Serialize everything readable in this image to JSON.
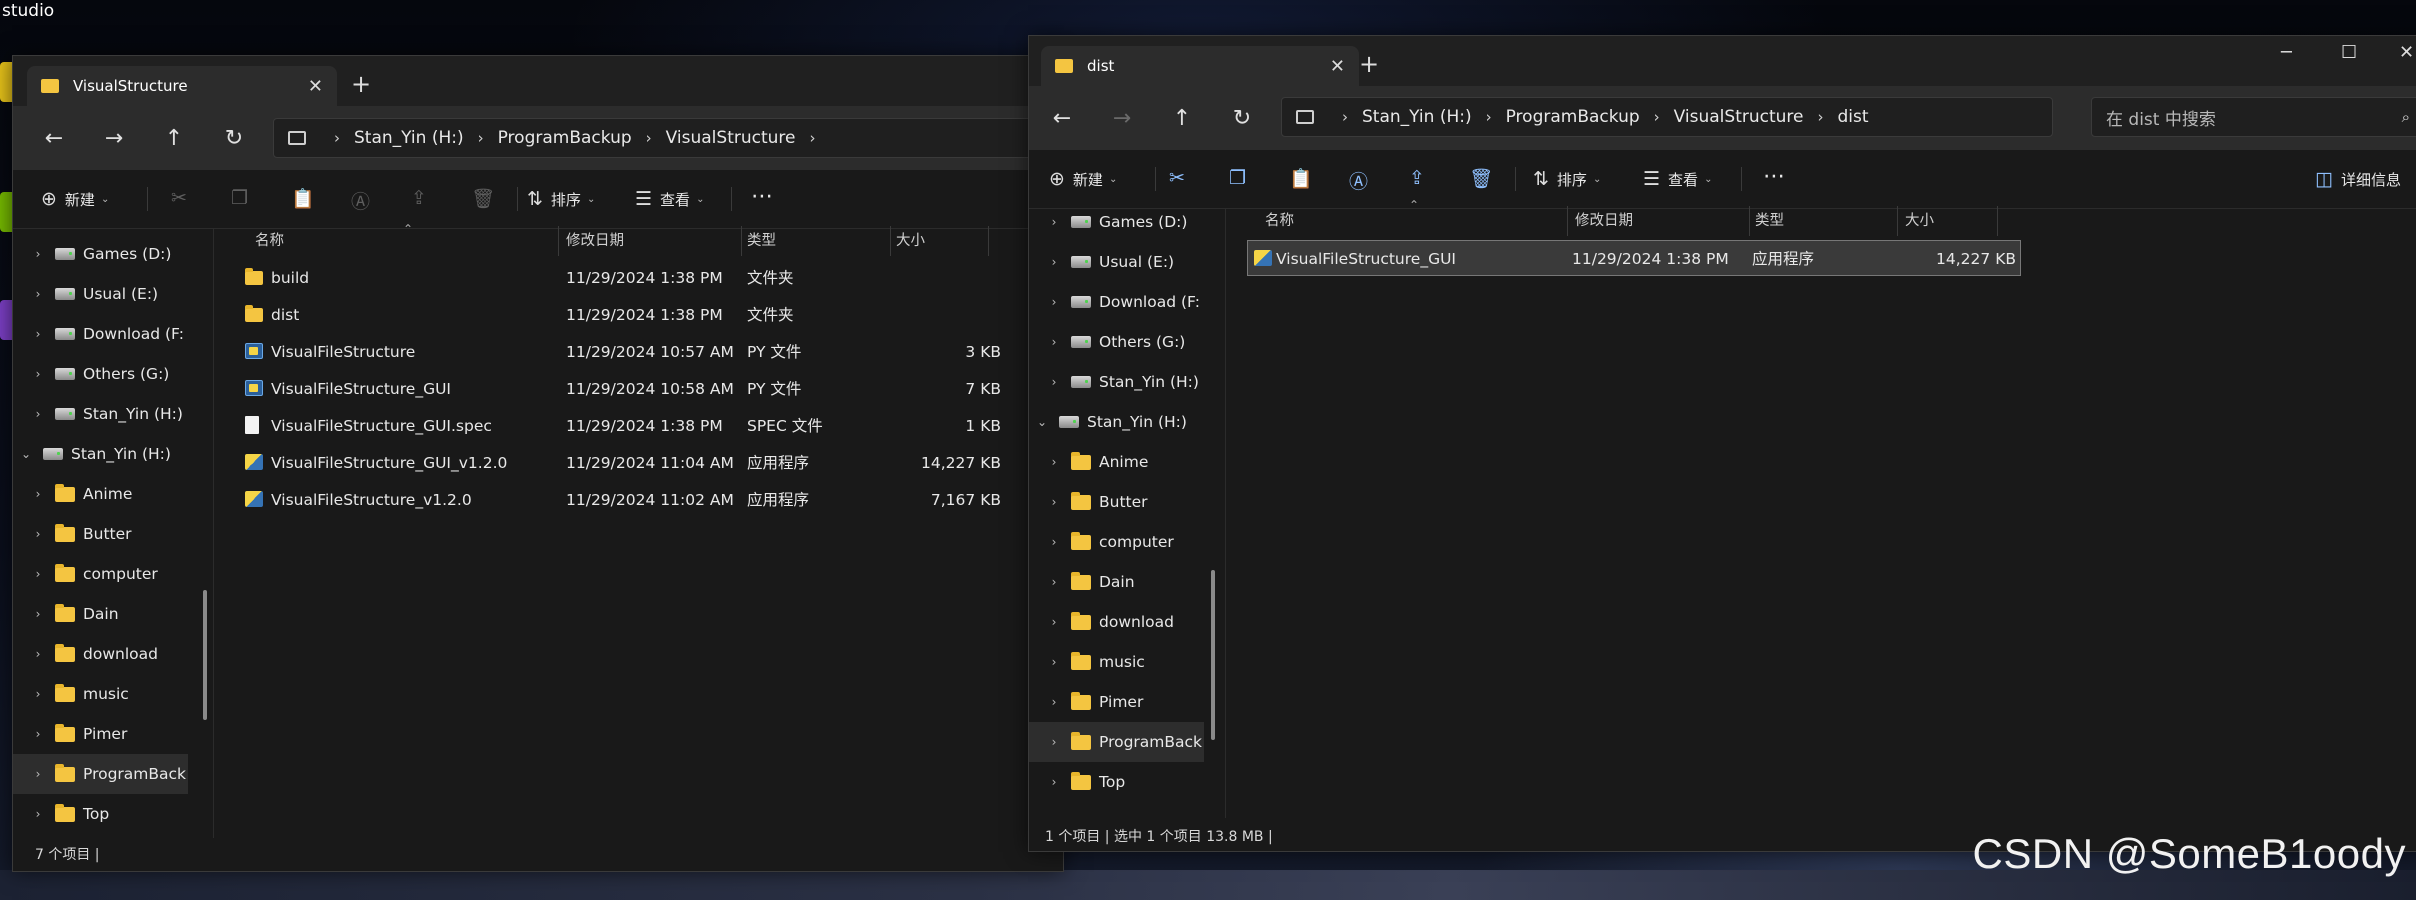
{
  "desktop": {
    "top_left_label": "studio",
    "watermark": "CSDN @SomeB1oody"
  },
  "left_window": {
    "tab_title": "VisualStructure",
    "breadcrumb": [
      "Stan_Yin (H:)",
      "ProgramBackup",
      "VisualStructure"
    ],
    "toolbar": {
      "new_label": "新建",
      "sort_label": "排序",
      "view_label": "查看"
    },
    "nav_items": [
      {
        "label": "Games (D:)",
        "kind": "drive",
        "level": 1,
        "expand": "›"
      },
      {
        "label": "Usual (E:)",
        "kind": "drive",
        "level": 1,
        "expand": "›"
      },
      {
        "label": "Download (F:",
        "kind": "drive",
        "level": 1,
        "expand": "›"
      },
      {
        "label": "Others (G:)",
        "kind": "drive",
        "level": 1,
        "expand": "›"
      },
      {
        "label": "Stan_Yin (H:)",
        "kind": "drive",
        "level": 1,
        "expand": "›"
      },
      {
        "label": "Stan_Yin (H:)",
        "kind": "drive",
        "level": 0,
        "expand": "⌄"
      },
      {
        "label": "Anime",
        "kind": "folder",
        "level": 1,
        "expand": "›"
      },
      {
        "label": "Butter",
        "kind": "folder",
        "level": 1,
        "expand": "›"
      },
      {
        "label": "computer",
        "kind": "folder",
        "level": 1,
        "expand": "›"
      },
      {
        "label": "Dain",
        "kind": "folder",
        "level": 1,
        "expand": "›"
      },
      {
        "label": "download",
        "kind": "folder",
        "level": 1,
        "expand": "›"
      },
      {
        "label": "music",
        "kind": "folder",
        "level": 1,
        "expand": "›"
      },
      {
        "label": "Pimer",
        "kind": "folder",
        "level": 1,
        "expand": "›"
      },
      {
        "label": "ProgramBack",
        "kind": "folder",
        "level": 1,
        "expand": "›",
        "selected": true
      },
      {
        "label": "Top",
        "kind": "folder",
        "level": 1,
        "expand": "›"
      }
    ],
    "columns": [
      "名称",
      "修改日期",
      "类型",
      "大小"
    ],
    "files": [
      {
        "name": "build",
        "date": "11/29/2024 1:38 PM",
        "type": "文件夹",
        "size": "",
        "icon": "folder"
      },
      {
        "name": "dist",
        "date": "11/29/2024 1:38 PM",
        "type": "文件夹",
        "size": "",
        "icon": "folder"
      },
      {
        "name": "VisualFileStructure",
        "date": "11/29/2024 10:57 AM",
        "type": "PY 文件",
        "size": "3 KB",
        "icon": "py"
      },
      {
        "name": "VisualFileStructure_GUI",
        "date": "11/29/2024 10:58 AM",
        "type": "PY 文件",
        "size": "7 KB",
        "icon": "py"
      },
      {
        "name": "VisualFileStructure_GUI.spec",
        "date": "11/29/2024 1:38 PM",
        "type": "SPEC 文件",
        "size": "1 KB",
        "icon": "spec"
      },
      {
        "name": "VisualFileStructure_GUI_v1.2.0",
        "date": "11/29/2024 11:04 AM",
        "type": "应用程序",
        "size": "14,227 KB",
        "icon": "app"
      },
      {
        "name": "VisualFileStructure_v1.2.0",
        "date": "11/29/2024 11:02 AM",
        "type": "应用程序",
        "size": "7,167 KB",
        "icon": "app"
      }
    ],
    "status": "7 个项目  |"
  },
  "right_window": {
    "tab_title": "dist",
    "breadcrumb": [
      "Stan_Yin (H:)",
      "ProgramBackup",
      "VisualStructure",
      "dist"
    ],
    "search_placeholder": "在 dist 中搜索",
    "toolbar": {
      "new_label": "新建",
      "sort_label": "排序",
      "view_label": "查看",
      "details_label": "详细信息"
    },
    "nav_items": [
      {
        "label": "Games (D:)",
        "kind": "drive",
        "level": 1,
        "expand": "›"
      },
      {
        "label": "Usual (E:)",
        "kind": "drive",
        "level": 1,
        "expand": "›"
      },
      {
        "label": "Download (F:",
        "kind": "drive",
        "level": 1,
        "expand": "›"
      },
      {
        "label": "Others (G:)",
        "kind": "drive",
        "level": 1,
        "expand": "›"
      },
      {
        "label": "Stan_Yin (H:)",
        "kind": "drive",
        "level": 1,
        "expand": "›"
      },
      {
        "label": "Stan_Yin (H:)",
        "kind": "drive",
        "level": 0,
        "expand": "⌄"
      },
      {
        "label": "Anime",
        "kind": "folder",
        "level": 1,
        "expand": "›"
      },
      {
        "label": "Butter",
        "kind": "folder",
        "level": 1,
        "expand": "›"
      },
      {
        "label": "computer",
        "kind": "folder",
        "level": 1,
        "expand": "›"
      },
      {
        "label": "Dain",
        "kind": "folder",
        "level": 1,
        "expand": "›"
      },
      {
        "label": "download",
        "kind": "folder",
        "level": 1,
        "expand": "›"
      },
      {
        "label": "music",
        "kind": "folder",
        "level": 1,
        "expand": "›"
      },
      {
        "label": "Pimer",
        "kind": "folder",
        "level": 1,
        "expand": "›"
      },
      {
        "label": "ProgramBack",
        "kind": "folder",
        "level": 1,
        "expand": "›",
        "selected": true
      },
      {
        "label": "Top",
        "kind": "folder",
        "level": 1,
        "expand": "›"
      }
    ],
    "columns": [
      "名称",
      "修改日期",
      "类型",
      "大小"
    ],
    "files": [
      {
        "name": "VisualFileStructure_GUI",
        "date": "11/29/2024 1:38 PM",
        "type": "应用程序",
        "size": "14,227 KB",
        "icon": "app",
        "selected": true
      }
    ],
    "status": "1 个项目  |  选中 1 个项目  13.8 MB  |"
  }
}
